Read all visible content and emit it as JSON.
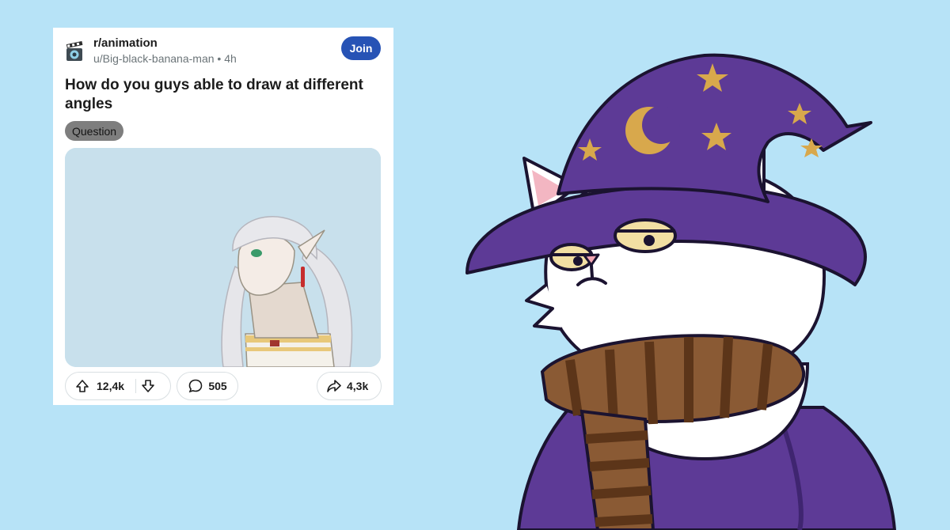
{
  "post": {
    "subreddit": "r/animation",
    "author_meta": "u/Big-black-banana-man • 4h",
    "join_label": "Join",
    "title": "How do you guys able to draw at different angles",
    "flair": "Question",
    "upvotes": "12,4k",
    "comments": "505",
    "shares": "4,3k"
  },
  "icons": {
    "subreddit": "film-camera-icon",
    "upvote": "arrow-up-icon",
    "downvote": "arrow-down-icon",
    "comment": "speech-bubble-icon",
    "share": "share-arrow-icon"
  },
  "colors": {
    "background": "#b7e3f7",
    "join_button": "#2753b5",
    "hat": "#5a3a9a",
    "scarf": "#8a5a34"
  }
}
